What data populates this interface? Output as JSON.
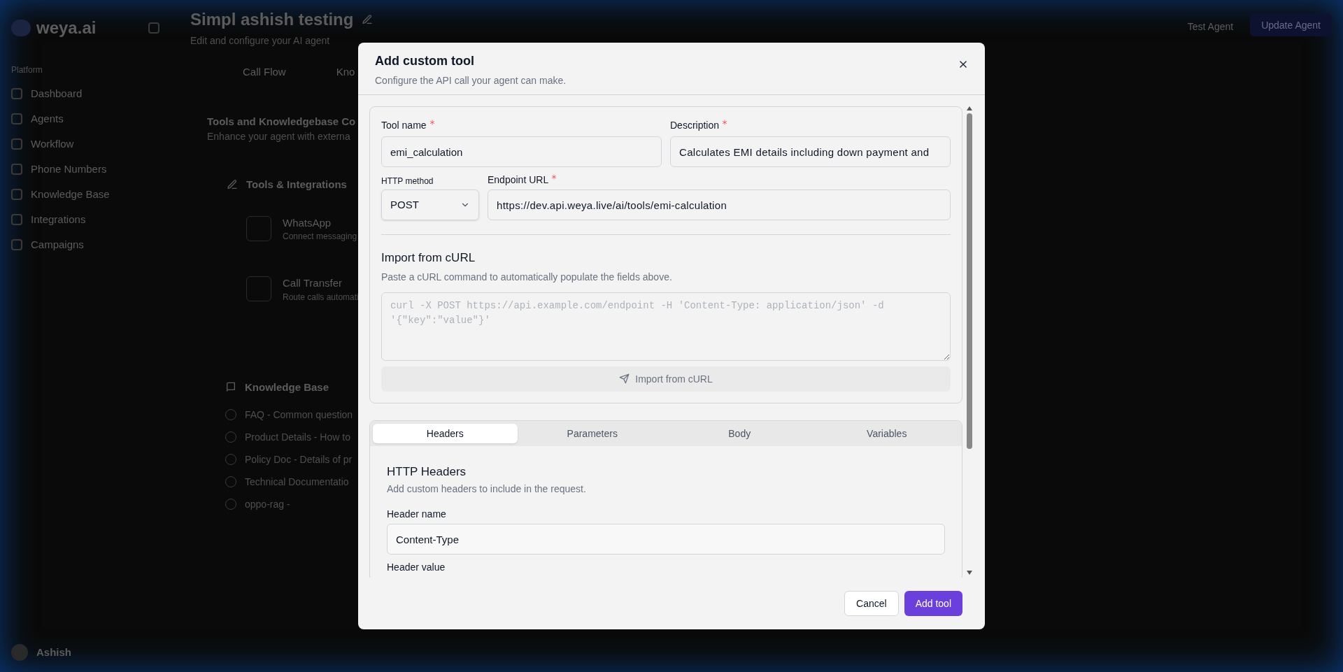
{
  "background": {
    "logo": "weya.ai",
    "sidebar": {
      "section": "Platform",
      "items": [
        "Dashboard",
        "Agents",
        "Workflow",
        "Phone Numbers",
        "Knowledge Base",
        "Integrations",
        "Campaigns"
      ]
    },
    "user": {
      "name": "Ashish"
    },
    "header": {
      "title": "Simpl ashish testing",
      "subtitle": "Edit and configure your AI agent",
      "test_button": "Test Agent",
      "update_button": "Update Agent"
    },
    "tabs": [
      "Call Flow",
      "Kno"
    ],
    "section": {
      "title": "Tools and Knowledgebase Co",
      "subtitle": "Enhance your agent with externa"
    },
    "tools": {
      "title": "Tools & Integrations",
      "items": [
        {
          "name": "WhatsApp",
          "description": "Connect messaging"
        },
        {
          "name": "Call Transfer",
          "description": "Route calls automati"
        }
      ]
    },
    "knowledge_base": {
      "title": "Knowledge Base",
      "items": [
        {
          "label": "FAQ - Common question",
          "checked": false
        },
        {
          "label": "Product Details - How to",
          "checked": false
        },
        {
          "label": "Policy Doc - Details of pr",
          "checked": false
        },
        {
          "label": "Technical Documentatio",
          "checked": false
        },
        {
          "label": "oppo-rag -",
          "checked": false
        }
      ]
    }
  },
  "dialog": {
    "title": "Add custom tool",
    "subtitle": "Configure the API call your agent can make.",
    "tool_name": {
      "label": "Tool name",
      "required": true,
      "value": "emi_calculation"
    },
    "description": {
      "label": "Description",
      "required": true,
      "value": "Calculates EMI details including down payment and"
    },
    "http_method": {
      "label": "HTTP method",
      "value": "POST"
    },
    "endpoint_url": {
      "label": "Endpoint URL",
      "required": true,
      "value": "https://dev.api.weya.live/ai/tools/emi-calculation"
    },
    "import_curl": {
      "title": "Import from cURL",
      "hint": "Paste a cURL command to automatically populate the fields above.",
      "placeholder": "curl -X POST https://api.example.com/endpoint -H 'Content-Type: application/json' -d '{\"key\":\"value\"}'",
      "button": "Import from cURL",
      "disabled": true
    },
    "tabs": [
      {
        "label": "Headers",
        "selected": true
      },
      {
        "label": "Parameters",
        "selected": false
      },
      {
        "label": "Body",
        "selected": false
      },
      {
        "label": "Variables",
        "selected": false
      }
    ],
    "headers": {
      "title": "HTTP Headers",
      "hint": "Add custom headers to include in the request.",
      "fields": [
        {
          "label": "Header name",
          "value": "Content-Type"
        },
        {
          "label": "Header value"
        }
      ]
    },
    "cancel_button": "Cancel",
    "submit_button": "Add tool"
  }
}
